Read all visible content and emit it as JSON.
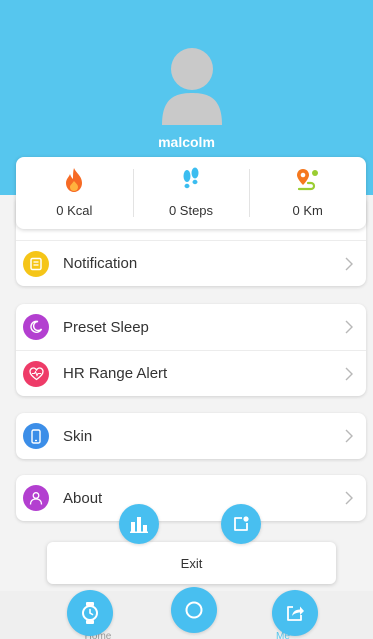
{
  "profile": {
    "username": "malcolm"
  },
  "stats": [
    {
      "icon": "flame-icon",
      "value": "0 Kcal"
    },
    {
      "icon": "footsteps-icon",
      "value": "0 Steps"
    },
    {
      "icon": "route-icon",
      "value": "0 Km"
    }
  ],
  "menu": {
    "notification": "Notification",
    "preset_sleep": "Preset Sleep",
    "hr_range_alert": "HR Range Alert",
    "skin": "Skin",
    "about": "About"
  },
  "colors": {
    "header": "#56c6ee",
    "accent": "#48bff0",
    "notification": "#f5c518",
    "sleep": "#b33fd0",
    "hr": "#ee3b68",
    "skin": "#3c8ee8",
    "about": "#b33fd0"
  },
  "exit_label": "Exit",
  "tabs": {
    "home": "Home",
    "me": "Me"
  }
}
